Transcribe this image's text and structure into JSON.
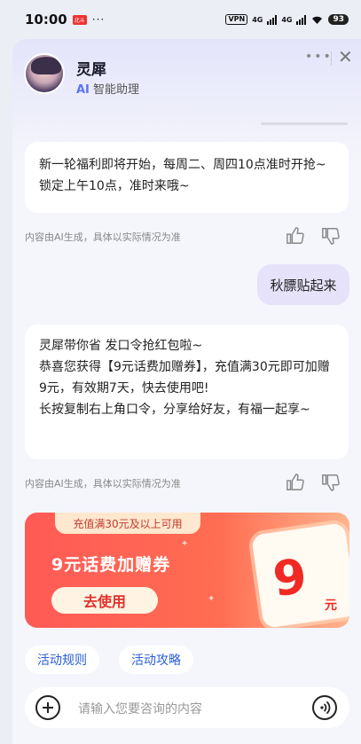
{
  "status_bar": {
    "time": "10:00",
    "badge": "北斗",
    "dots": "···",
    "vpn": "VPN",
    "net1": "4G",
    "net2": "4G",
    "battery": "93"
  },
  "header": {
    "name": "灵犀",
    "subtitle_ai": "AI",
    "subtitle_rest": "智能助理"
  },
  "messages": {
    "bot1": "新一轮福利即将开始，每周二、周四10点准时开抢~锁定上午10点，准时来哦~",
    "hint": "内容由AI生成，具体以实际情况为准",
    "user1": "秋膘贴起来",
    "bot2_lines": [
      "灵犀带你省 发口令抢红包啦~",
      "恭喜您获得【9元话费加赠券】，充值满30元即可加赠9元，有效期7天，快去使用吧!",
      "长按复制右上角口令，分享给好友，有福一起享~"
    ]
  },
  "coupon": {
    "tag": "充值满30元及以上可用",
    "title": "9元话费加赠券",
    "button": "去使用",
    "amount": "9",
    "unit": "元",
    "colors": {
      "start": "#ff5a56",
      "end": "#ffb48e"
    }
  },
  "chips": [
    "活动规则",
    "活动攻略"
  ],
  "input": {
    "placeholder": "请输入您要咨询的内容"
  },
  "icons": [
    "more-icon",
    "close-icon",
    "thumbs-up-icon",
    "thumbs-down-icon",
    "plus-icon",
    "voice-icon"
  ]
}
